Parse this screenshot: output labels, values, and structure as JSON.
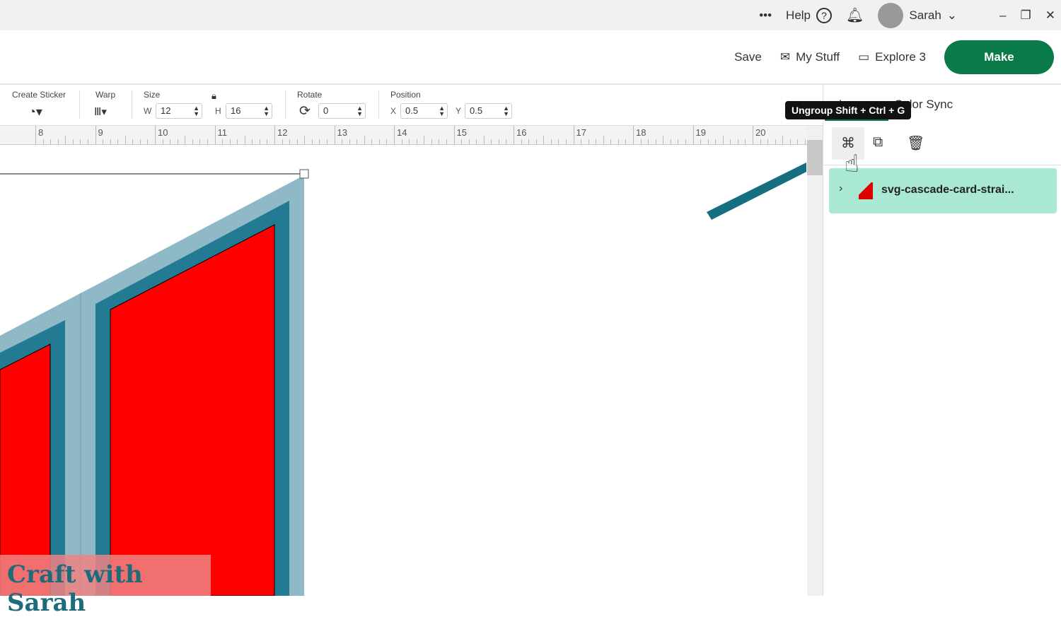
{
  "topbar": {
    "more": "•••",
    "help": "Help",
    "user": "Sarah"
  },
  "header": {
    "save": "Save",
    "my_stuff": "My Stuff",
    "machine": "Explore 3",
    "make": "Make"
  },
  "toolbar": {
    "create_sticker": "Create Sticker",
    "warp": "Warp",
    "size": "Size",
    "w_label": "W",
    "w": "12",
    "h_label": "H",
    "h": "16",
    "rotate": "Rotate",
    "rotate_value": "0",
    "position": "Position",
    "x_label": "X",
    "x": "0.5",
    "y_label": "Y",
    "y": "0.5"
  },
  "ruler": [
    "8",
    "9",
    "10",
    "11",
    "12",
    "13",
    "14",
    "15",
    "16",
    "17",
    "18",
    "19",
    "20"
  ],
  "panel": {
    "tab_layers": "Layers",
    "tab_color_sync": "Color Sync",
    "tooltip": "Ungroup Shift + Ctrl + G",
    "layer_name": "svg-cascade-card-strai..."
  },
  "watermark": "Craft with Sarah",
  "colors": {
    "accent": "#0a7a4b",
    "layer_bg": "#a9e8d2",
    "card_red": "#ff0000",
    "card_teal": "#237b93",
    "card_light": "#8fb9c6",
    "arrow": "#156f80"
  }
}
